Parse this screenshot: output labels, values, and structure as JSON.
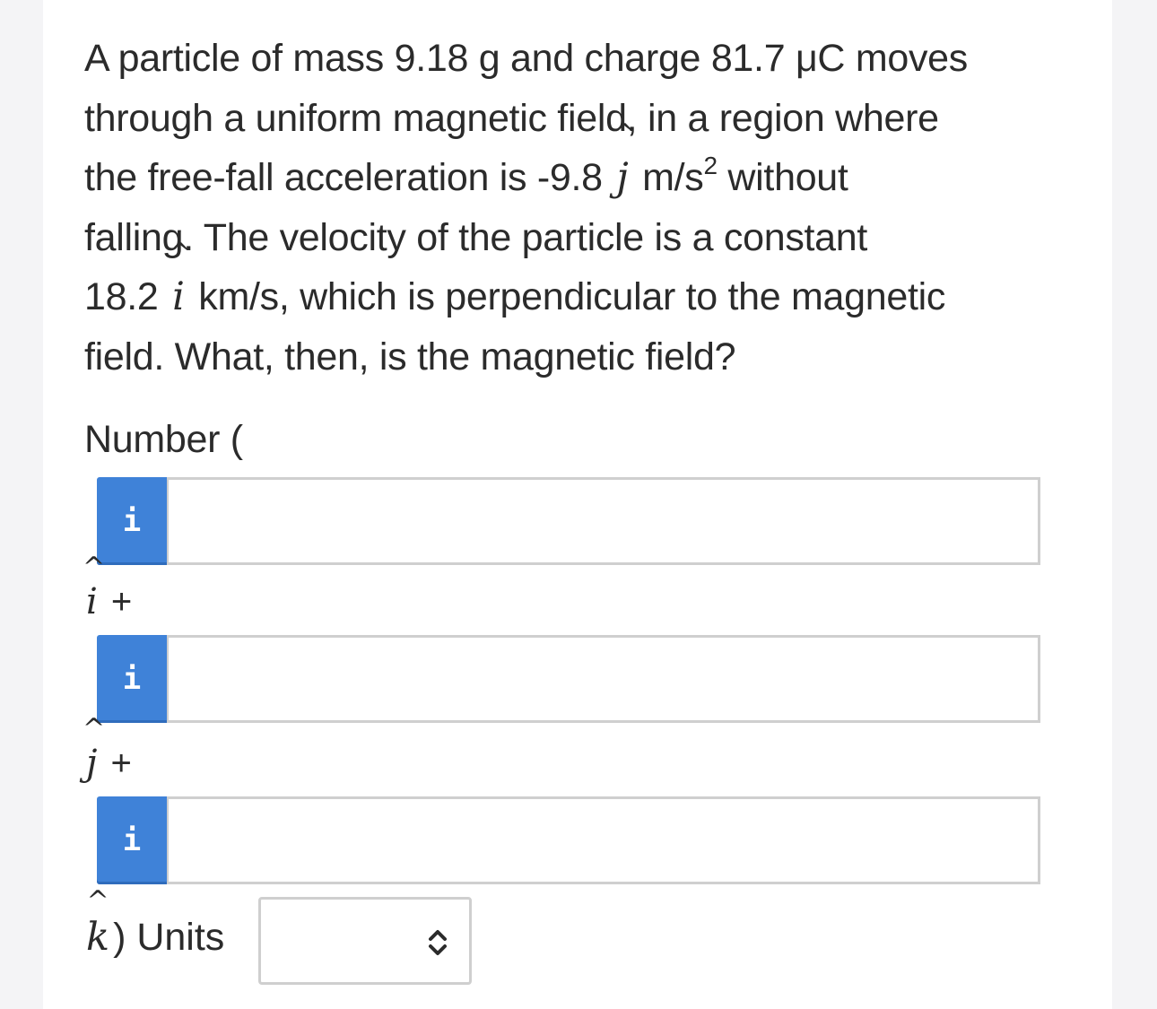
{
  "question": {
    "line1": "A particle of mass 9.18 g and charge 81.7 μC moves",
    "line2": "through a uniform magnetic field, in a region where",
    "line3_pre": "the free-fall acceleration is -9.8",
    "line3_unit": "m/s",
    "line3_exp": "2",
    "line3_post": " without",
    "line4": "falling. The velocity of the particle is a constant",
    "line5_pre": "18.2",
    "line5_post": " km/s, which is perpendicular to the magnetic",
    "line6": "field. What, then, is the magnetic field?"
  },
  "unit_vectors": {
    "i": "i",
    "j": "j",
    "k": "k",
    "hat": "^"
  },
  "answer": {
    "number_label": "Number (",
    "info_icon_glyph": "i",
    "i_component": {
      "value": "",
      "suffix": " +"
    },
    "j_component": {
      "value": "",
      "suffix": " +"
    },
    "k_component": {
      "value": "",
      "suffix": ") Units"
    },
    "units": {
      "selected": ""
    }
  },
  "colors": {
    "accent": "#3f82d8",
    "text": "#2b2b2b",
    "input_border": "#cfcfcf"
  },
  "icons": {
    "info_button": "info-icon",
    "units_dropdown": "chevron-up-down-icon"
  }
}
